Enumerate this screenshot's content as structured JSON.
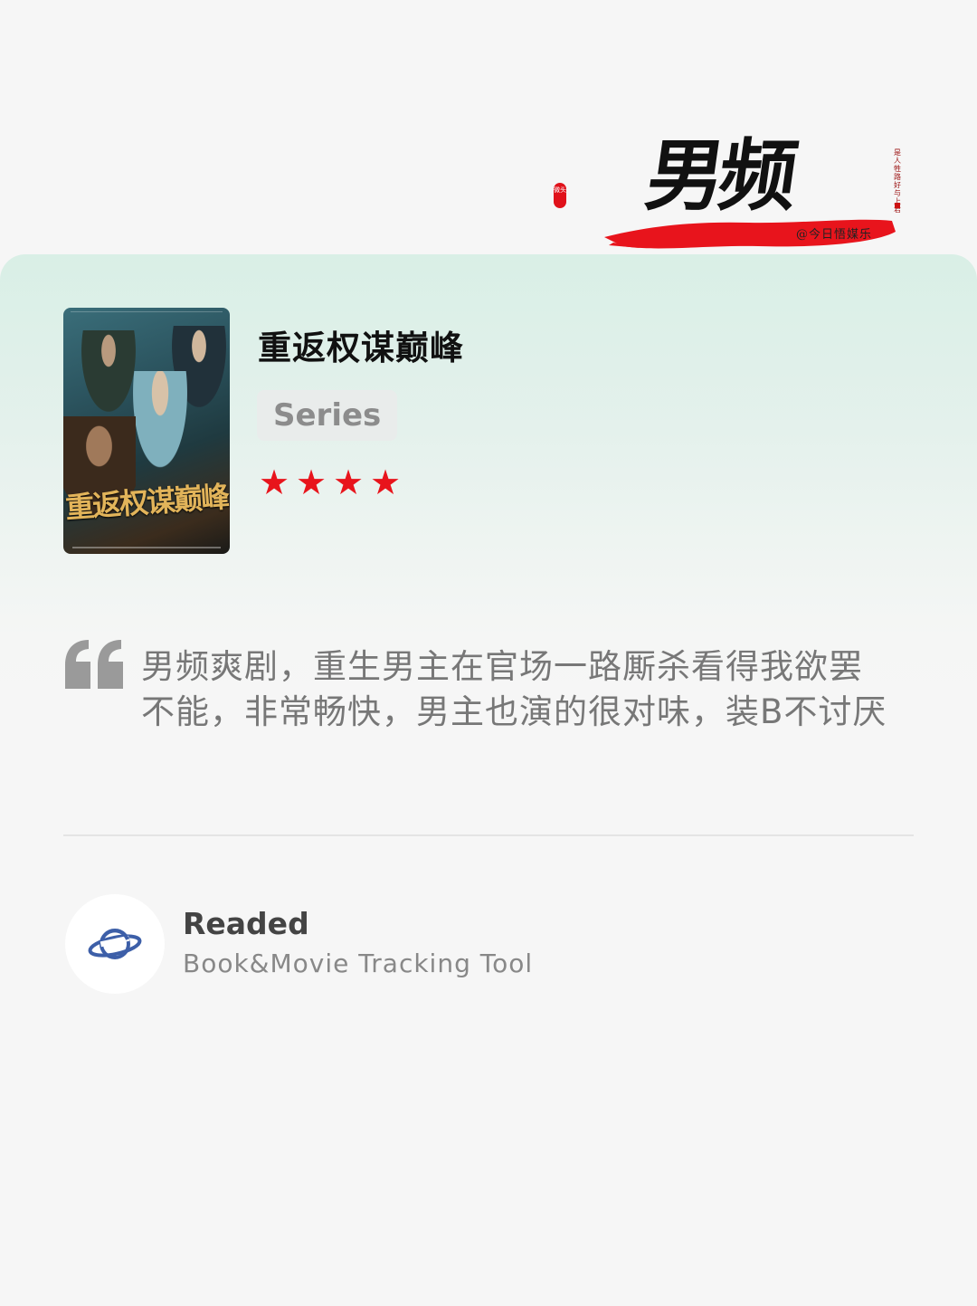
{
  "header": {
    "banner_text": "男频",
    "banner_subtitle": "@今日悟媒乐",
    "seal_text": "微头",
    "vertical_credit": "是人牲路好与上君"
  },
  "item": {
    "title": "重返权谋巅峰",
    "type_label": "Series",
    "rating": 4,
    "rating_max": 4,
    "poster_title": "重返权谋巅峰"
  },
  "review": {
    "text": "男频爽剧，重生男主在官场一路厮杀看得我欲罢不能，非常畅快，男主也演的很对味，装B不讨厌"
  },
  "footer": {
    "app_name": "Readed",
    "app_tagline": "Book&Movie Tracking Tool",
    "logo_icon": "planet-icon"
  },
  "colors": {
    "star": "#e8141c",
    "card_gradient_top": "#d9efe6",
    "background": "#f6f6f6",
    "logo_blue": "#3d5fa8"
  }
}
